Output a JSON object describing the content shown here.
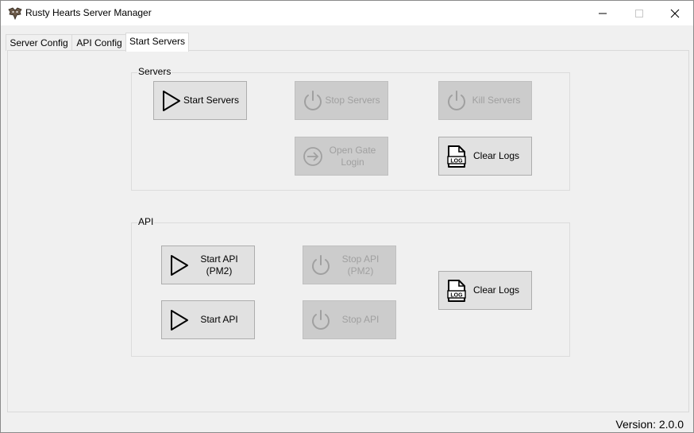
{
  "window": {
    "title": "Rusty Hearts Server Manager",
    "minimize_glyph": "–",
    "close_glyph": "✕"
  },
  "tabs": [
    {
      "label": "Server Config",
      "active": false
    },
    {
      "label": "API Config",
      "active": false
    },
    {
      "label": "Start Servers",
      "active": true
    }
  ],
  "servers_group": {
    "label": "Servers",
    "buttons": {
      "start": {
        "label": "Start Servers",
        "icon": "play-icon",
        "enabled": true
      },
      "stop": {
        "label": "Stop Servers",
        "icon": "power-icon",
        "enabled": false
      },
      "kill": {
        "label": "Kill Servers",
        "icon": "power-icon",
        "enabled": false
      },
      "open_gate": {
        "label": "Open Gate\nLogin",
        "icon": "login-arrow-icon",
        "enabled": false
      },
      "clear_logs": {
        "label": "Clear Logs",
        "icon": "log-file-icon",
        "icon_text": "LOG",
        "enabled": true
      }
    }
  },
  "api_group": {
    "label": "API",
    "buttons": {
      "start_pm2": {
        "label": "Start API\n(PM2)",
        "icon": "play-icon",
        "enabled": true
      },
      "stop_pm2": {
        "label": "Stop API\n(PM2)",
        "icon": "power-icon",
        "enabled": false
      },
      "start": {
        "label": "Start API",
        "icon": "play-icon",
        "enabled": true
      },
      "stop": {
        "label": "Stop API",
        "icon": "power-icon",
        "enabled": false
      },
      "clear_logs": {
        "label": "Clear Logs",
        "icon": "log-file-icon",
        "icon_text": "LOG",
        "enabled": true
      }
    }
  },
  "footer": {
    "version": "Version: 2.0.0"
  },
  "colors": {
    "enabled_button": "#e1e1e1",
    "disabled_button": "#cccccc",
    "disabled_text": "#a0a0a0"
  }
}
